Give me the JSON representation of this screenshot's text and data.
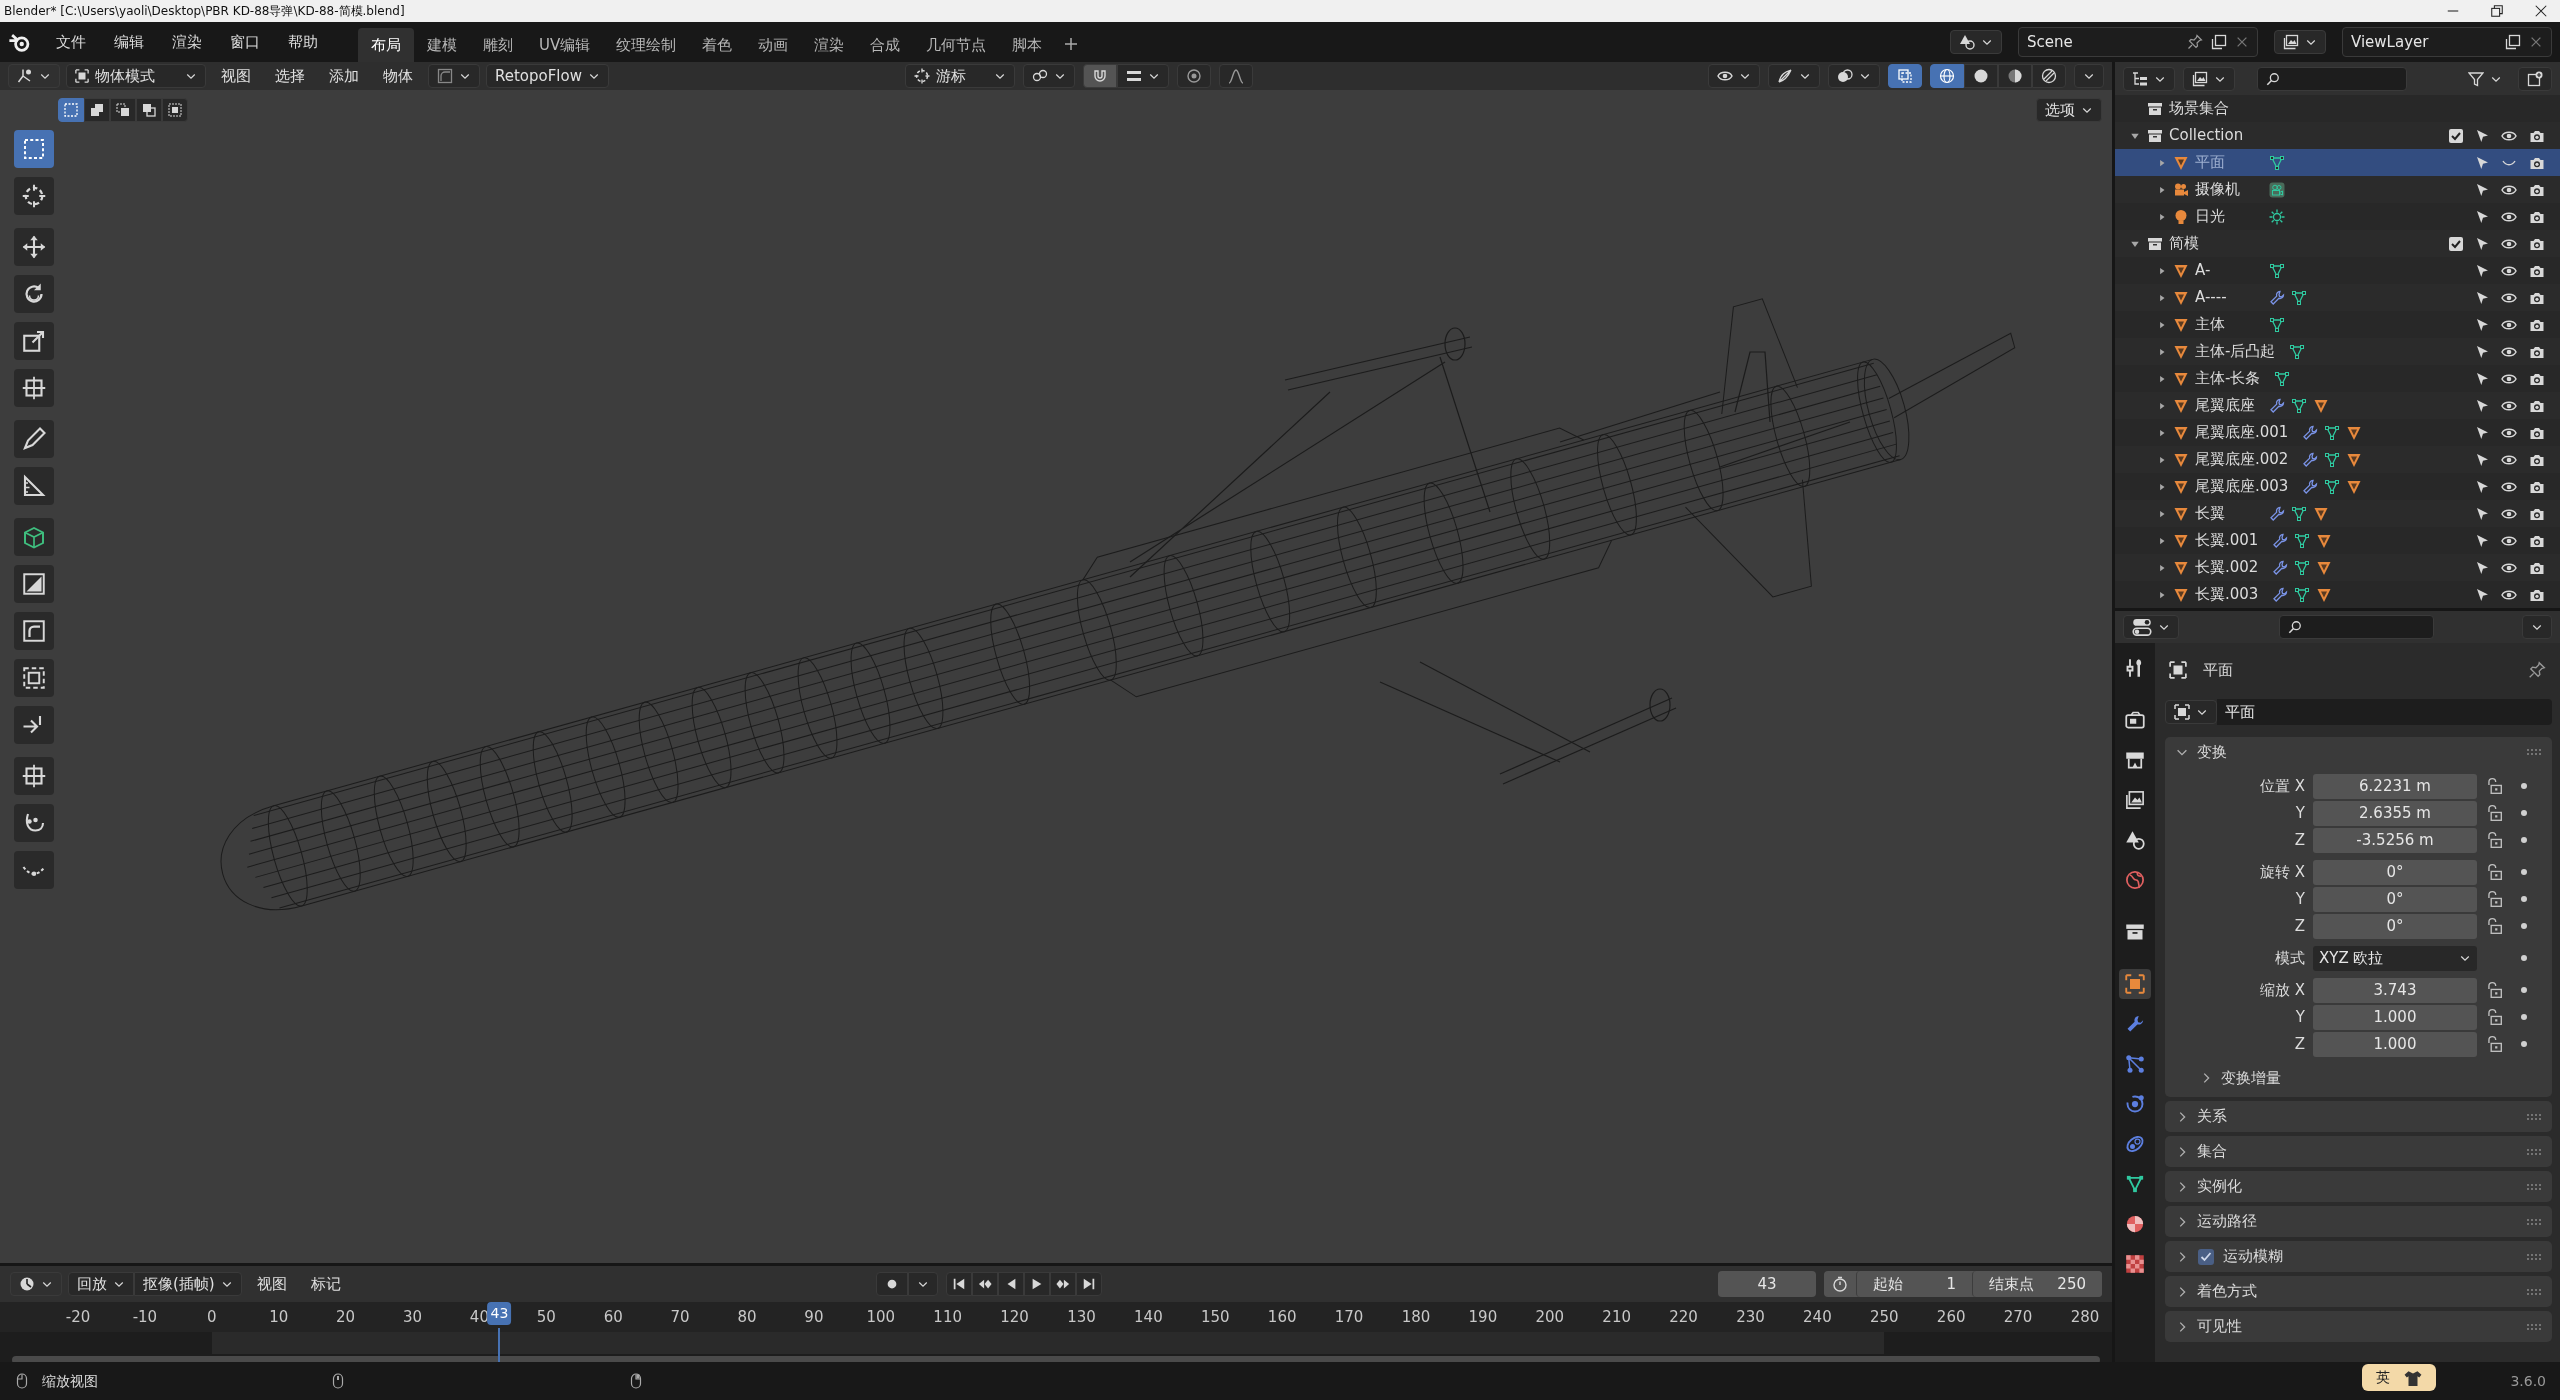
{
  "title_bar": {
    "title": "Blender* [C:\\Users\\yaoli\\Desktop\\PBR KD-88导弹\\KD-88-简模.blend]"
  },
  "menu_bar": {
    "menus": [
      "文件",
      "编辑",
      "渲染",
      "窗口",
      "帮助"
    ],
    "workspaces": [
      {
        "label": "布局",
        "selected": true
      },
      {
        "label": "建模",
        "selected": false
      },
      {
        "label": "雕刻",
        "selected": false
      },
      {
        "label": "UV编辑",
        "selected": false
      },
      {
        "label": "纹理绘制",
        "selected": false
      },
      {
        "label": "着色",
        "selected": false
      },
      {
        "label": "动画",
        "selected": false
      },
      {
        "label": "渲染",
        "selected": false
      },
      {
        "label": "合成",
        "selected": false
      },
      {
        "label": "几何节点",
        "selected": false
      },
      {
        "label": "脚本",
        "selected": false
      }
    ],
    "scene": "Scene",
    "view_layer": "ViewLayer"
  },
  "viewport": {
    "mode": "物体模式",
    "menus": [
      "视图",
      "选择",
      "添加",
      "物体"
    ],
    "addon_menu": "RetopoFlow",
    "pivot": "游标",
    "snap": true,
    "xray": true,
    "shading": [
      {
        "selected": true
      },
      {
        "selected": false
      },
      {
        "selected": false
      },
      {
        "selected": false
      }
    ],
    "select_modes": [
      {
        "selected": true
      },
      {
        "selected": false
      },
      {
        "selected": false
      },
      {
        "selected": false
      },
      {
        "selected": false
      }
    ],
    "options": "选项",
    "tools": [
      {
        "selected": true
      },
      {
        "selected": false
      },
      {
        "selected": false
      },
      {
        "selected": false
      },
      {
        "selected": false
      },
      {
        "selected": false
      },
      {
        "selected": false
      },
      {
        "selected": false
      },
      {
        "selected": false
      },
      {
        "selected": false
      },
      {
        "selected": false
      },
      {
        "selected": false
      },
      {
        "selected": false
      },
      {
        "selected": false
      },
      {
        "selected": false
      },
      {
        "selected": false
      }
    ]
  },
  "outliner": {
    "root": "场景集合",
    "items": [
      {
        "label": "Collection",
        "kind": "collection",
        "expanded": true,
        "checked": true,
        "selected": false,
        "visible": true,
        "children": [
          {
            "label": "平面",
            "kind": "mesh",
            "selected": true,
            "visible": false,
            "badges": [
              {
                "kind": "mesh_data"
              }
            ]
          },
          {
            "label": "摄像机",
            "kind": "camera",
            "selected": false,
            "visible": true,
            "badges": [
              {
                "kind": "camera_data"
              }
            ]
          },
          {
            "label": "日光",
            "kind": "light",
            "selected": false,
            "visible": true,
            "badges": [
              {
                "kind": "light_data"
              }
            ]
          }
        ]
      },
      {
        "label": "简模",
        "kind": "collection",
        "expanded": true,
        "checked": true,
        "selected": false,
        "visible": true,
        "children": [
          {
            "label": "A-",
            "kind": "mesh",
            "selected": false,
            "visible": true,
            "badges": [
              {
                "kind": "mesh_data"
              }
            ]
          },
          {
            "label": "A----",
            "kind": "mesh",
            "selected": false,
            "visible": true,
            "badges": [
              {
                "kind": "modifier"
              },
              {
                "kind": "mesh_data"
              }
            ]
          },
          {
            "label": "主体",
            "kind": "mesh",
            "selected": false,
            "visible": true,
            "badges": [
              {
                "kind": "mesh_data"
              }
            ]
          },
          {
            "label": "主体-后凸起",
            "kind": "mesh",
            "selected": false,
            "visible": true,
            "badges": [
              {
                "kind": "mesh_data"
              }
            ]
          },
          {
            "label": "主体-长条",
            "kind": "mesh",
            "selected": false,
            "visible": true,
            "badges": [
              {
                "kind": "mesh_data"
              }
            ]
          },
          {
            "label": "尾翼底座",
            "kind": "mesh",
            "selected": false,
            "visible": true,
            "badges": [
              {
                "kind": "modifier"
              },
              {
                "kind": "mesh_data"
              },
              {
                "kind": "mesh"
              }
            ]
          },
          {
            "label": "尾翼底座.001",
            "kind": "mesh",
            "selected": false,
            "visible": true,
            "badges": [
              {
                "kind": "modifier"
              },
              {
                "kind": "mesh_data"
              },
              {
                "kind": "mesh"
              }
            ]
          },
          {
            "label": "尾翼底座.002",
            "kind": "mesh",
            "selected": false,
            "visible": true,
            "badges": [
              {
                "kind": "modifier"
              },
              {
                "kind": "mesh_data"
              },
              {
                "kind": "mesh"
              }
            ]
          },
          {
            "label": "尾翼底座.003",
            "kind": "mesh",
            "selected": false,
            "visible": true,
            "badges": [
              {
                "kind": "modifier"
              },
              {
                "kind": "mesh_data"
              },
              {
                "kind": "mesh"
              }
            ]
          },
          {
            "label": "长翼",
            "kind": "mesh",
            "selected": false,
            "visible": true,
            "badges": [
              {
                "kind": "modifier"
              },
              {
                "kind": "mesh_data"
              },
              {
                "kind": "mesh"
              }
            ]
          },
          {
            "label": "长翼.001",
            "kind": "mesh",
            "selected": false,
            "visible": true,
            "badges": [
              {
                "kind": "modifier"
              },
              {
                "kind": "mesh_data"
              },
              {
                "kind": "mesh"
              }
            ]
          },
          {
            "label": "长翼.002",
            "kind": "mesh",
            "selected": false,
            "visible": true,
            "badges": [
              {
                "kind": "modifier"
              },
              {
                "kind": "mesh_data"
              },
              {
                "kind": "mesh"
              }
            ]
          },
          {
            "label": "长翼.003",
            "kind": "mesh",
            "selected": false,
            "visible": true,
            "badges": [
              {
                "kind": "modifier"
              },
              {
                "kind": "mesh_data"
              },
              {
                "kind": "mesh"
              }
            ]
          }
        ]
      }
    ]
  },
  "properties": {
    "tabs": [
      {
        "selected": false
      },
      {
        "selected": false
      },
      {
        "selected": false
      },
      {
        "selected": false
      },
      {
        "selected": false
      },
      {
        "selected": false
      },
      {
        "selected": false
      },
      {
        "selected": true
      },
      {
        "selected": false
      },
      {
        "selected": false
      },
      {
        "selected": false
      },
      {
        "selected": false
      },
      {
        "selected": false
      },
      {
        "selected": false
      },
      {
        "selected": false
      }
    ],
    "object_name": "平面",
    "datablock": "平面",
    "transform": {
      "title": "变换",
      "expanded": true,
      "groups": [
        [
          {
            "label": "位置 X",
            "value": "6.2231 m",
            "kind": "number"
          },
          {
            "label": "Y",
            "value": "2.6355 m",
            "kind": "number"
          },
          {
            "label": "Z",
            "value": "-3.5256 m",
            "kind": "number"
          }
        ],
        [
          {
            "label": "旋转 X",
            "value": "0°",
            "kind": "number"
          },
          {
            "label": "Y",
            "value": "0°",
            "kind": "number"
          },
          {
            "label": "Z",
            "value": "0°",
            "kind": "number"
          }
        ],
        [
          {
            "label": "模式",
            "value": "XYZ 欧拉",
            "kind": "dropdown"
          }
        ],
        [
          {
            "label": "缩放 X",
            "value": "3.743",
            "kind": "number"
          },
          {
            "label": "Y",
            "value": "1.000",
            "kind": "number"
          },
          {
            "label": "Z",
            "value": "1.000",
            "kind": "number"
          }
        ]
      ],
      "subpanels": [
        {
          "title": "变换增量",
          "expanded": false
        }
      ]
    },
    "panels": [
      {
        "title": "关系",
        "expanded": false
      },
      {
        "title": "集合",
        "expanded": false
      },
      {
        "title": "实例化",
        "expanded": false
      },
      {
        "title": "运动路径",
        "expanded": false
      },
      {
        "title": "运动模糊",
        "expanded": false,
        "checked": true
      },
      {
        "title": "着色方式",
        "expanded": false
      },
      {
        "title": "可见性",
        "expanded": false
      }
    ]
  },
  "timeline": {
    "menus": [
      {
        "label": "回放",
        "kind": "dropdown"
      },
      {
        "label": "抠像(插帧)",
        "kind": "dropdown"
      },
      {
        "label": "视图",
        "kind": "plain"
      },
      {
        "label": "标记",
        "kind": "plain"
      }
    ],
    "current_frame": "43",
    "start_label": "起始",
    "start": "1",
    "end_label": "结束点",
    "end": "250",
    "ruler": [
      "-20",
      "-10",
      "0",
      "10",
      "20",
      "30",
      "40",
      "50",
      "60",
      "70",
      "80",
      "90",
      "100",
      "110",
      "120",
      "130",
      "140",
      "150",
      "160",
      "170",
      "180",
      "190",
      "200",
      "210",
      "220",
      "230",
      "240",
      "250",
      "260",
      "270",
      "280"
    ],
    "playhead": "43"
  },
  "status_bar": {
    "hint": "缩放视图",
    "ime": "英",
    "version": "3.6.0"
  }
}
